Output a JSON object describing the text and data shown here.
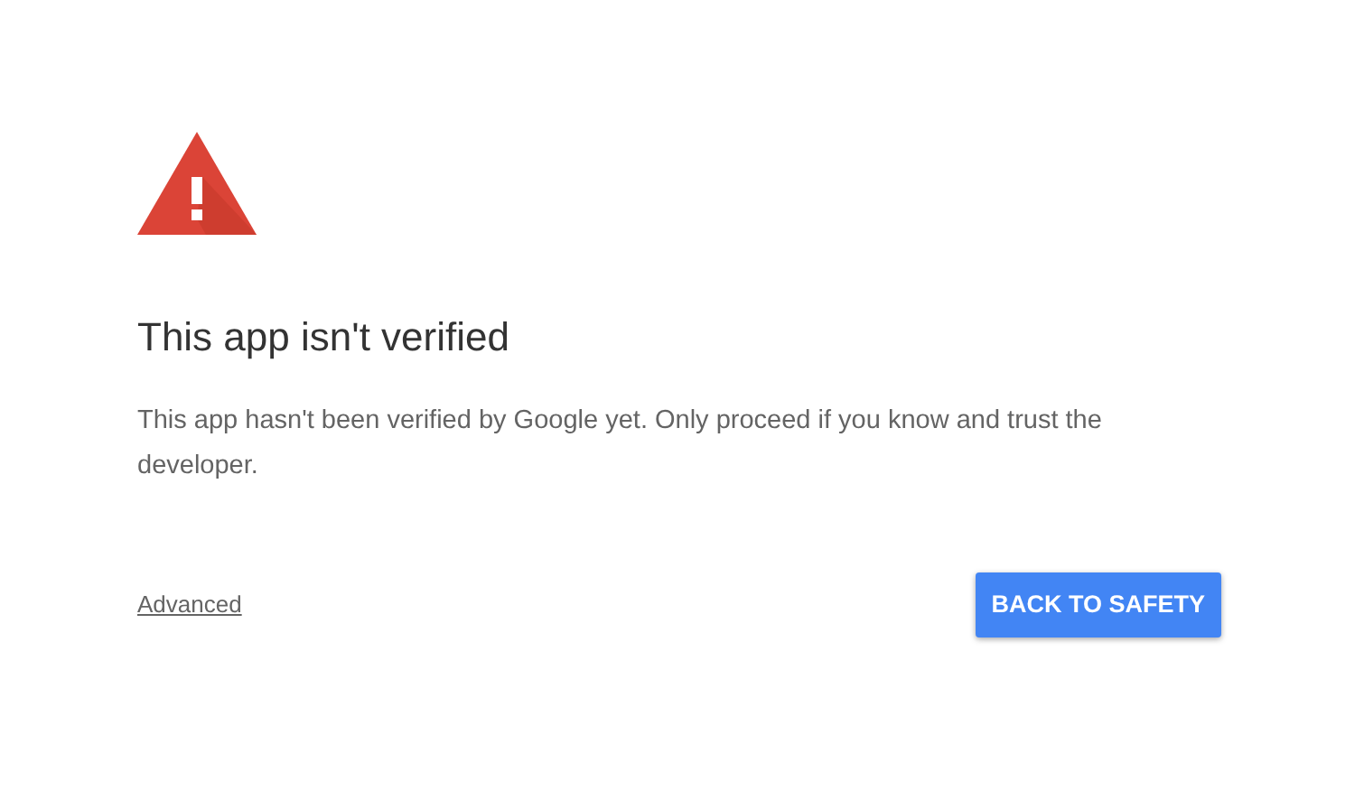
{
  "heading": "This app isn't verified",
  "message": "This app hasn't been verified by Google yet. Only proceed if you know and trust the developer.",
  "advanced_link": "Advanced",
  "back_button": "BACK TO SAFETY"
}
